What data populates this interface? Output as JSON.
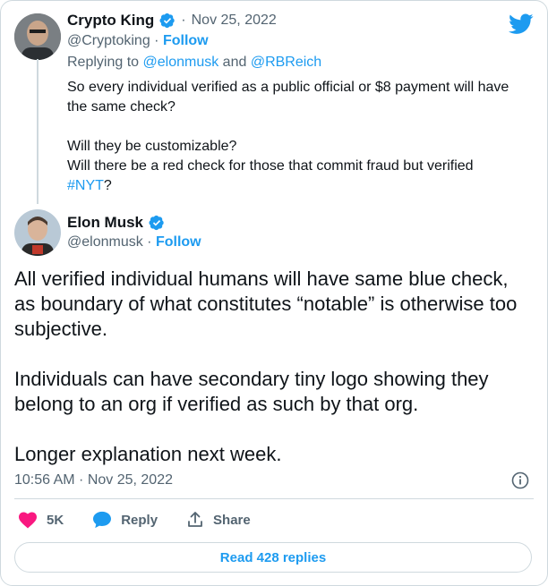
{
  "reply_tweet": {
    "name": "Crypto King",
    "handle": "@Cryptoking",
    "date": "Nov 25, 2022",
    "follow_label": "Follow",
    "replying_prefix": "Replying to",
    "replying_to_1": "@elonmusk",
    "replying_join": "and",
    "replying_to_2": "@RBReich",
    "line1": "So every individual verified as a public official or $8 payment will have",
    "line2": "the same check?",
    "line3": "Will they be customizable?",
    "line4": "Will there be a red check for those that commit fraud but verified",
    "hashtag": "#NYT",
    "hashtag_suffix": "?"
  },
  "main_tweet": {
    "name": "Elon Musk",
    "handle": "@elonmusk",
    "follow_label": "Follow",
    "p1_l1": "All verified individual humans will have same blue check,",
    "p1_l2": "as boundary of what constitutes “notable” is otherwise too",
    "p1_l3": "subjective.",
    "p2_l1": "Individuals can have secondary tiny logo showing they",
    "p2_l2": "belong to an org if verified as such by that org.",
    "p3_l1": "Longer explanation next week.",
    "timestamp": "10:56 AM · Nov 25, 2022"
  },
  "actions": {
    "likes": "5K",
    "reply_label": "Reply",
    "share_label": "Share"
  },
  "read_replies_label": "Read 428 replies",
  "colors": {
    "accent": "#1d9bf0",
    "like": "#f91880",
    "muted": "#536471"
  },
  "icons": [
    "twitter-bird-icon",
    "verified-badge-icon",
    "info-icon",
    "heart-icon",
    "reply-bubble-icon",
    "share-icon"
  ]
}
